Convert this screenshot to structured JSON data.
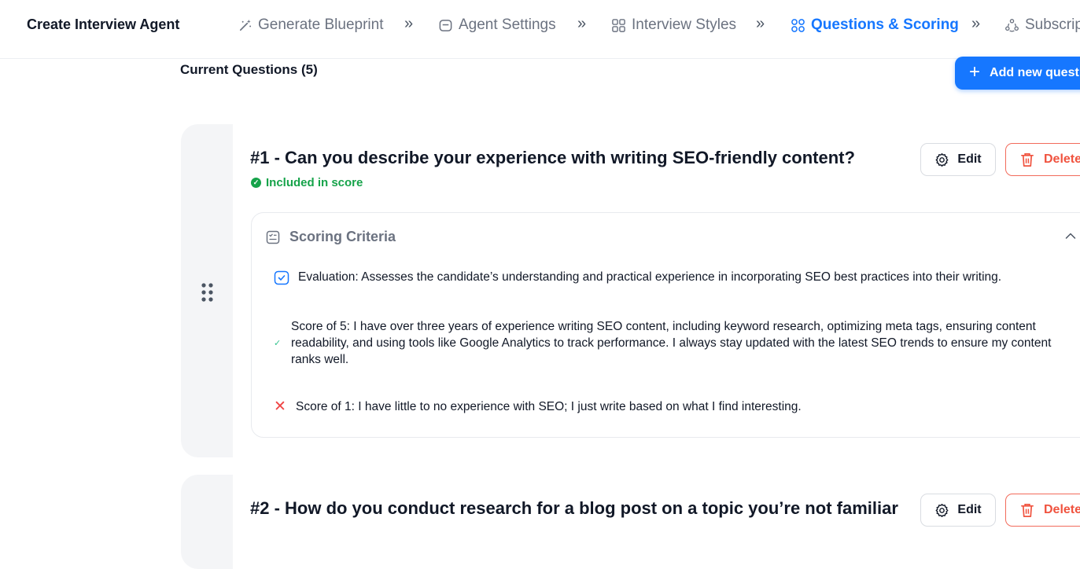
{
  "header": {
    "app_title": "Create Interview Agent",
    "steps": [
      {
        "label": "Generate Blueprint",
        "icon": "magic-wand-icon"
      },
      {
        "label": "Agent Settings",
        "icon": "agent-box-icon"
      },
      {
        "label": "Interview Styles",
        "icon": "grid-icon"
      },
      {
        "label": "Questions & Scoring",
        "icon": "grid-icon",
        "active": true
      },
      {
        "label": "Subscrip",
        "icon": "subscription-icon"
      }
    ],
    "separator": "»"
  },
  "section": {
    "title": "Current Questions (5)",
    "add_button_label": "Add new quest"
  },
  "questions": [
    {
      "title": "#1 - Can you describe your experience with writing SEO-friendly content?",
      "included_label": "Included in score",
      "edit_label": "Edit",
      "delete_label": "Delete",
      "criteria_title": "Scoring Criteria",
      "evaluation": "Evaluation: Assesses the candidate’s understanding and practical experience in incorporating SEO best practices into their writing.",
      "score_high": "Score of 5: I have over three years of experience writing SEO content, including keyword research, optimizing meta tags, ensuring content readability, and using tools like Google Analytics to track performance. I always stay updated with the latest SEO trends to ensure my content ranks well.",
      "score_low": "Score of 1: I have little to no experience with SEO; I just write based on what I find interesting."
    },
    {
      "title": "#2 - How do you conduct research for a blog post on a topic you’re not familiar",
      "edit_label": "Edit",
      "delete_label": "Delete"
    }
  ],
  "colors": {
    "accent": "#1677ff",
    "success": "#16a34a",
    "danger": "#f0533f"
  }
}
